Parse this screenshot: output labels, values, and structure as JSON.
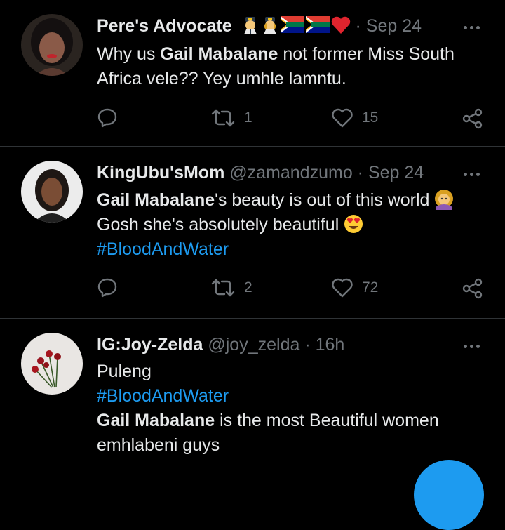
{
  "tweets": [
    {
      "name": "Pere's Advocate",
      "handle": "",
      "time": "· Sep 24",
      "lines": [
        [
          "Why us ",
          "Gail Mabalane",
          " not former Miss South"
        ],
        [
          "Africa vele?? Yey umhle lamntu."
        ]
      ],
      "replies": "",
      "retweets": "1",
      "likes": "15"
    },
    {
      "name": "KingUbu'sMom",
      "handle": "@zamandzumo",
      "time": "· Sep 24",
      "line1_bold": "Gail Mabalane",
      "line1_rest": "'s beauty is out of this world",
      "line2": "Gosh she's absolutely beautiful",
      "hashtag": "#BloodAndWater",
      "replies": "",
      "retweets": "2",
      "likes": "72"
    },
    {
      "name": "IG:Joy-Zelda",
      "handle": "@joy_zelda",
      "time": "· 16h",
      "line1": "Puleng",
      "hashtag": "#BloodAndWater",
      "line3_bold": "Gail Mabalane",
      "line3_rest": " is the most Beautiful women",
      "line4": "emhlabeni guys"
    }
  ],
  "icons": {
    "reply": "reply-icon",
    "retweet": "retweet-icon",
    "like": "heart-icon",
    "share": "share-icon",
    "more": "more-icon"
  },
  "colors": {
    "background": "#000000",
    "accent": "#1d9bf0",
    "muted": "#71767b",
    "text": "#e7e9ea"
  }
}
